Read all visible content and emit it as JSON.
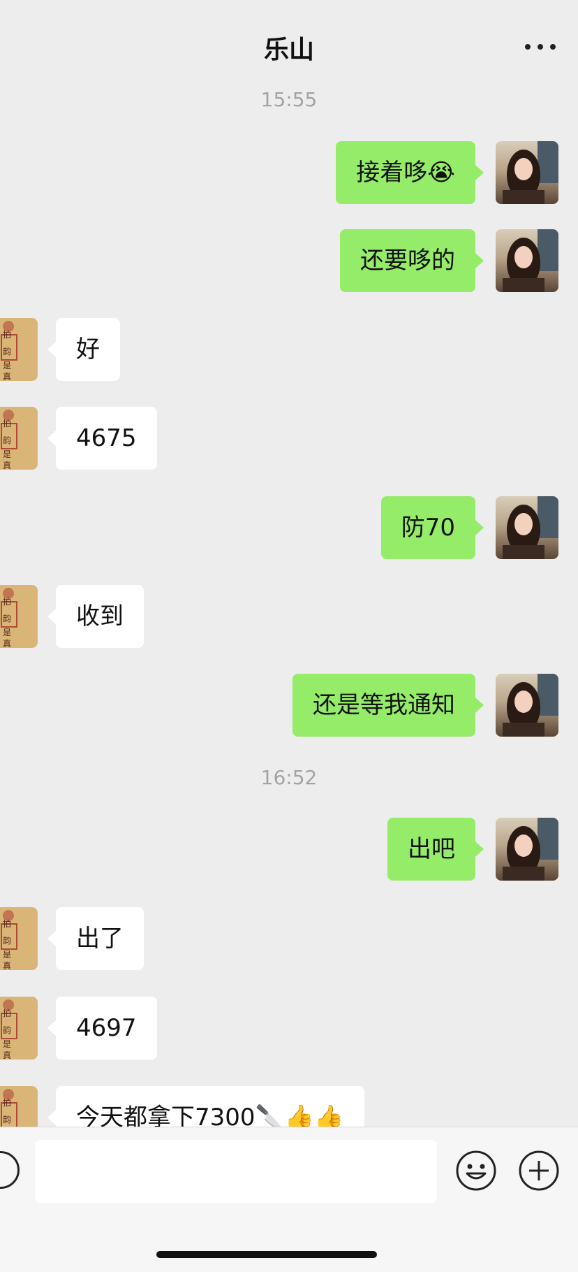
{
  "header": {
    "title": "乐山",
    "more_icon": "more-dots-icon"
  },
  "timestamps": [
    "15:55",
    "16:52"
  ],
  "messages": [
    {
      "side": "right",
      "text": "接着哆😭"
    },
    {
      "side": "right",
      "text": "还要哆的"
    },
    {
      "side": "left",
      "text": "好"
    },
    {
      "side": "left",
      "text": "4675"
    },
    {
      "side": "right",
      "text": "防70"
    },
    {
      "side": "left",
      "text": "收到"
    },
    {
      "side": "right",
      "text": "还是等我通知"
    },
    {
      "side": "right",
      "text": "出吧"
    },
    {
      "side": "left",
      "text": "出了"
    },
    {
      "side": "left",
      "text": "4697"
    },
    {
      "side": "left",
      "text": "今天都拿下7300🔪👍👍"
    }
  ],
  "input": {
    "placeholder": "",
    "value": ""
  },
  "colors": {
    "self_bubble": "#95ec69",
    "other_bubble": "#ffffff",
    "background": "#ededed"
  }
}
